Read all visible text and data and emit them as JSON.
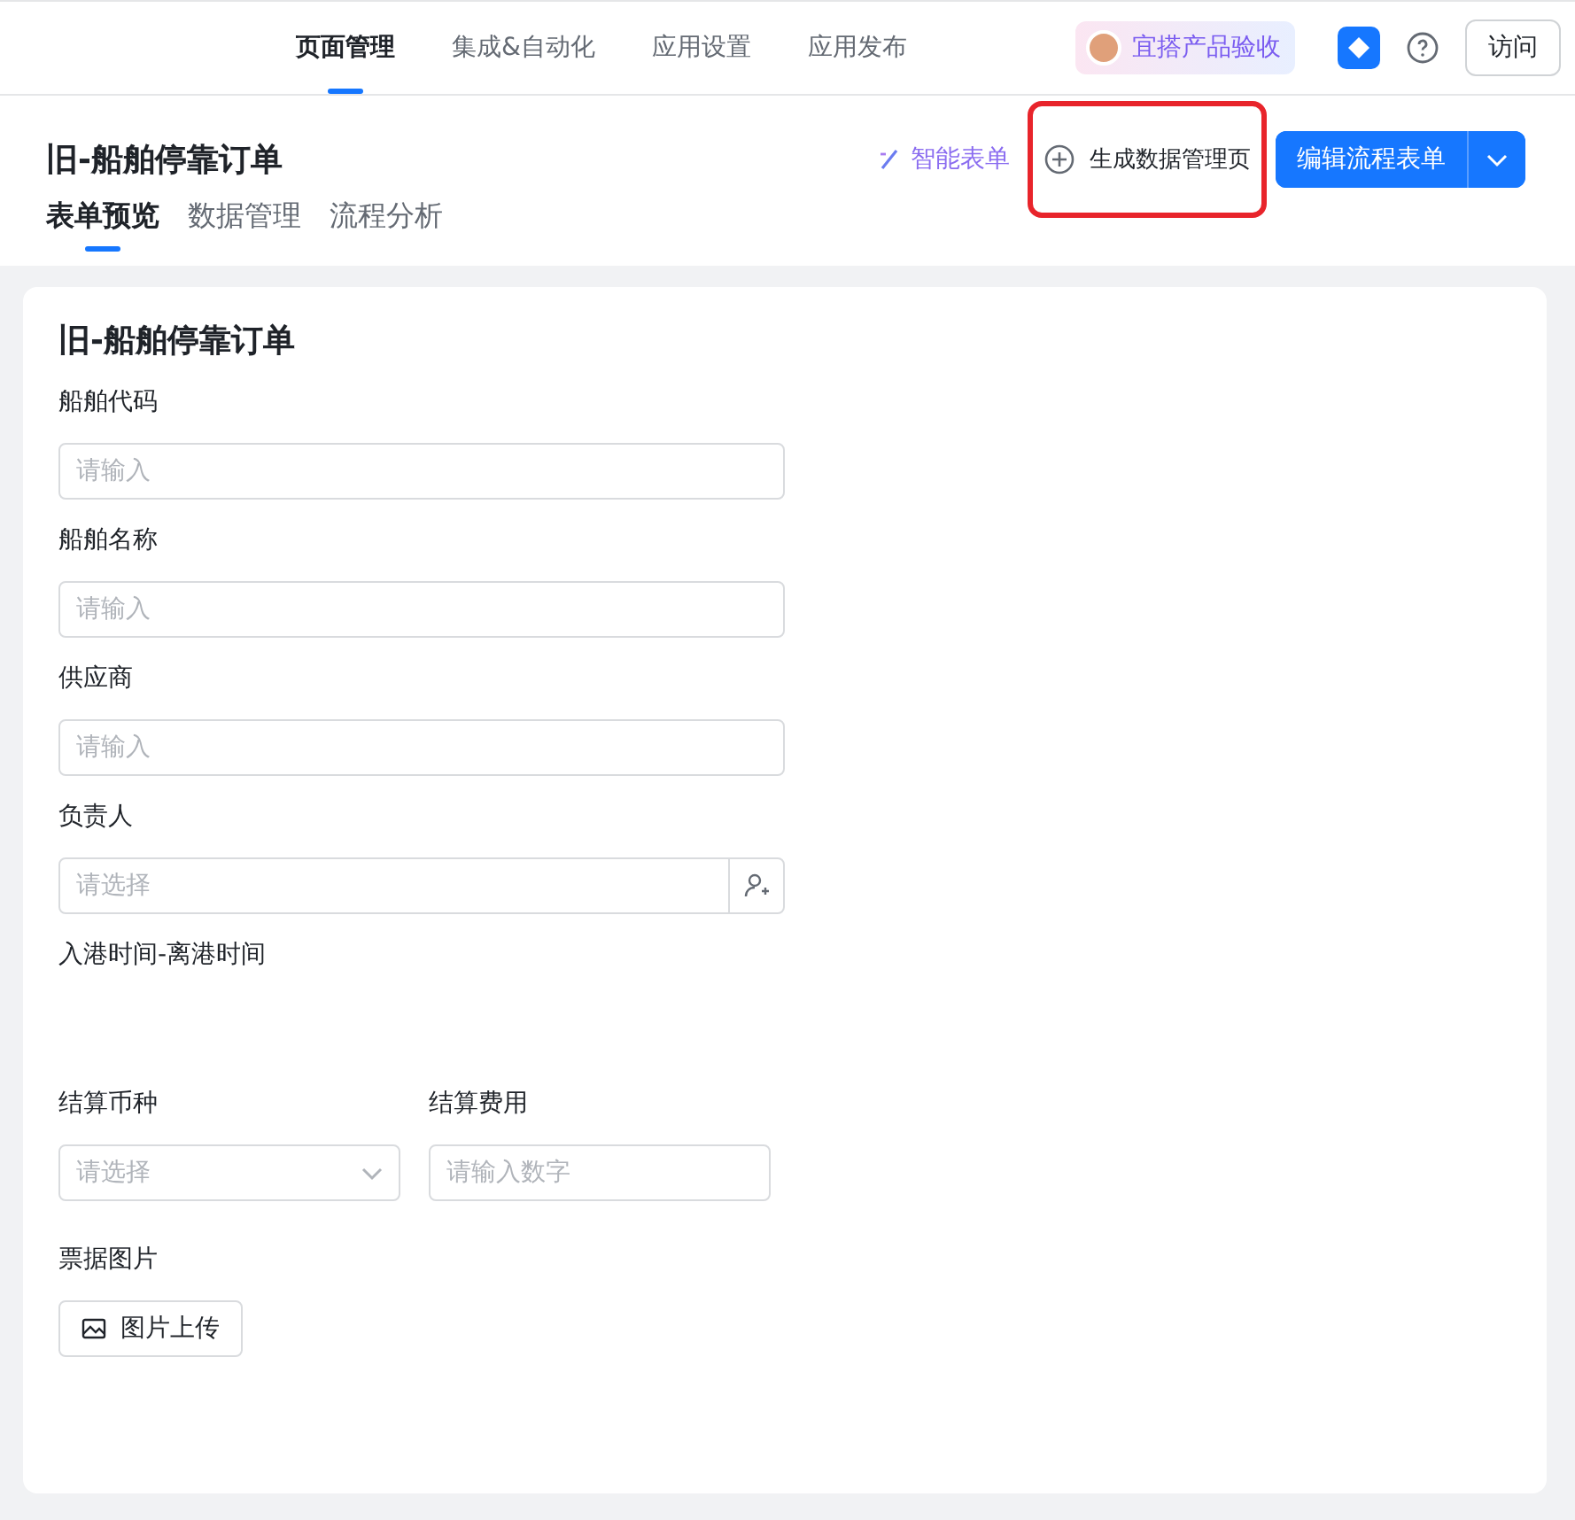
{
  "top_nav": {
    "tabs": [
      {
        "label": "页面管理",
        "selected": true
      },
      {
        "label": "集成&自动化",
        "selected": false
      },
      {
        "label": "应用设置",
        "selected": false
      },
      {
        "label": "应用发布",
        "selected": false
      }
    ],
    "badge": "宜搭产品验收",
    "visit_button": "访问"
  },
  "header": {
    "title": "旧-船舶停靠订单",
    "smart_form": "智能表单",
    "generate_button": {
      "label": "生成数据管理页",
      "highlighted": true
    },
    "edit_button": "编辑流程表单",
    "tabs": [
      {
        "label": "表单预览",
        "selected": true
      },
      {
        "label": "数据管理",
        "selected": false
      },
      {
        "label": "流程分析",
        "selected": false
      }
    ]
  },
  "form": {
    "title": "旧-船舶停靠订单",
    "fields": [
      {
        "kind": "input",
        "label": "船舶代码",
        "placeholder": "请输入"
      },
      {
        "kind": "input",
        "label": "船舶名称",
        "placeholder": "请输入"
      },
      {
        "kind": "input",
        "label": "供应商",
        "placeholder": "请输入"
      },
      {
        "kind": "person",
        "label": "负责人",
        "placeholder": "请选择"
      },
      {
        "kind": "blank",
        "label": "入港时间-离港时间"
      },
      {
        "kind": "pair",
        "items": [
          {
            "kind": "select",
            "label": "结算币种",
            "placeholder": "请选择"
          },
          {
            "kind": "number",
            "label": "结算费用",
            "placeholder": "请输入数字"
          }
        ]
      },
      {
        "kind": "upload",
        "label": "票据图片",
        "button": "图片上传"
      }
    ]
  }
}
